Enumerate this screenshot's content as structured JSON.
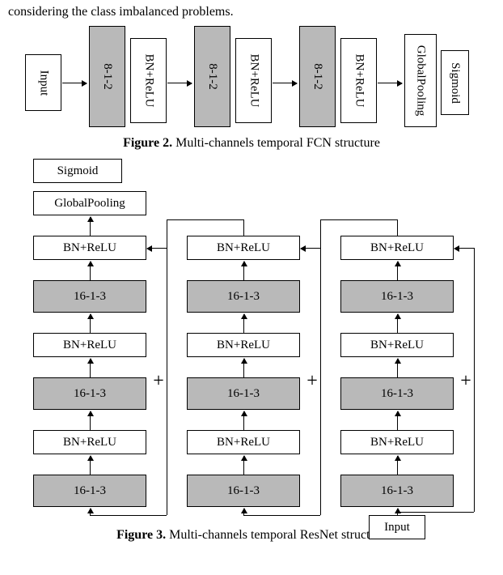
{
  "body_text": "considering the class imbalanced problems.",
  "fig2": {
    "caption_prefix": "Figure 2.",
    "caption_text": " Multi-channels temporal FCN structure",
    "input": "Input",
    "conv": "8-1-2",
    "bnrelu": "BN+ReLU",
    "pool": "GlobalPooling",
    "sigmoid": "Sigmoid"
  },
  "fig3": {
    "caption_prefix": "Figure 3.",
    "caption_text": " Multi-channels temporal ResNet structure",
    "input": "Input",
    "conv": "16-1-3",
    "bnrelu": "BN+ReLU",
    "pool": "GlobalPooling",
    "sigmoid": "Sigmoid",
    "plus": "+"
  }
}
